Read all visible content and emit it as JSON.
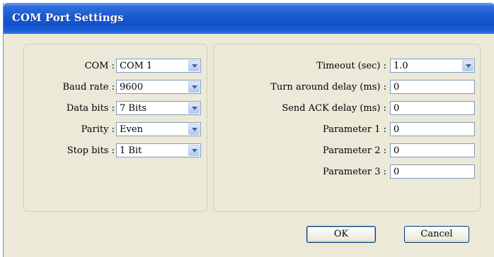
{
  "window": {
    "title": "COM Port Settings"
  },
  "left": {
    "com": {
      "label": "COM :",
      "value": "COM 1"
    },
    "baud": {
      "label": "Baud rate :",
      "value": "9600"
    },
    "databits": {
      "label": "Data bits :",
      "value": "7 Bits"
    },
    "parity": {
      "label": "Parity :",
      "value": "Even"
    },
    "stopbits": {
      "label": "Stop bits :",
      "value": "1 Bit"
    }
  },
  "right": {
    "timeout": {
      "label": "Timeout (sec) :",
      "value": "1.0"
    },
    "turnaround": {
      "label": "Turn around delay (ms) :",
      "value": "0"
    },
    "sendack": {
      "label": "Send ACK delay (ms) :",
      "value": "0"
    },
    "param1": {
      "label": "Parameter 1 :",
      "value": "0"
    },
    "param2": {
      "label": "Parameter 2 :",
      "value": "0"
    },
    "param3": {
      "label": "Parameter 3 :",
      "value": "0"
    }
  },
  "buttons": {
    "ok": "OK",
    "cancel": "Cancel"
  },
  "icons": {
    "dropdown": "chevron-down-icon"
  },
  "colors": {
    "titlebar": "#1452cb",
    "face": "#ece9d8",
    "border": "#7f9db9"
  }
}
